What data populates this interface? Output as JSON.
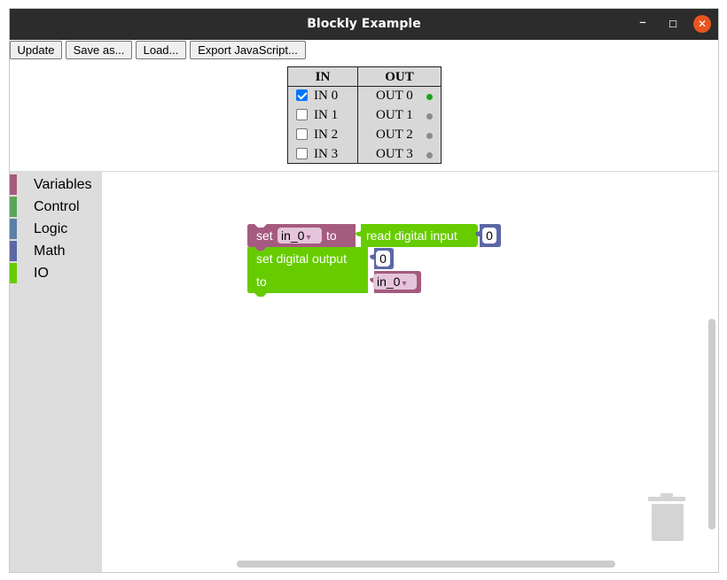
{
  "window": {
    "title": "Blockly Example",
    "controls": {
      "minimize": "–",
      "maximize": "☐",
      "close": "✕"
    }
  },
  "toolbar": {
    "update": "Update",
    "save_as": "Save as...",
    "load": "Load...",
    "export_js": "Export JavaScript..."
  },
  "io_table": {
    "in_header": "IN",
    "out_header": "OUT",
    "inputs": [
      {
        "label": "IN 0",
        "checked": true
      },
      {
        "label": "IN 1",
        "checked": false
      },
      {
        "label": "IN 2",
        "checked": false
      },
      {
        "label": "IN 3",
        "checked": false
      }
    ],
    "outputs": [
      {
        "label": "OUT 0",
        "led_color": "#1aa51a"
      },
      {
        "label": "OUT 1",
        "led_color": "#8c8c8c"
      },
      {
        "label": "OUT 2",
        "led_color": "#8c8c8c"
      },
      {
        "label": "OUT 3",
        "led_color": "#8c8c8c"
      }
    ]
  },
  "toolbox": {
    "categories": [
      {
        "label": "Variables",
        "color": "#a55b80"
      },
      {
        "label": "Control",
        "color": "#5ba55b"
      },
      {
        "label": "Logic",
        "color": "#5b80a5"
      },
      {
        "label": "Math",
        "color": "#5b67a5"
      },
      {
        "label": "IO",
        "color": "#66cc00"
      }
    ]
  },
  "blocks": {
    "set_var": {
      "set": "set",
      "var": "in_0",
      "to": "to"
    },
    "read_input": {
      "label": "read digital input",
      "value": "0"
    },
    "set_output": {
      "label": "set digital output",
      "value": "0",
      "to": "to"
    },
    "get_var": {
      "var": "in_0"
    },
    "dropdown_arrow": "▾"
  },
  "colors": {
    "variables": "#a55b80",
    "io": "#66cc00",
    "math": "#5b67a5"
  }
}
